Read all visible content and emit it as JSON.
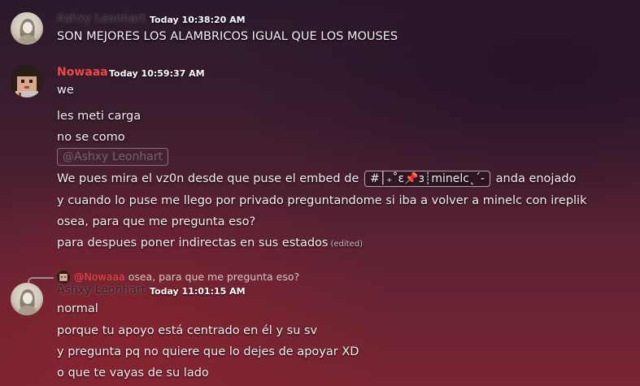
{
  "messages": [
    {
      "author": "Ashxy Leonhart",
      "timestamp": "Today 10:38:20 AM",
      "lines": [
        "SON MEJORES LOS ALAMBRICOS IGUAL QUE LOS MOUSES"
      ]
    },
    {
      "author": "Nowaaa",
      "timestamp": "Today 10:59:37 AM",
      "lines": [
        "we",
        "les meti carga",
        "no se como",
        "@Ashxy Leonhart",
        "We pues mira el vz0n desde que puse el embed de",
        "#│₊˚ɛ📌ɜ┊minelc˛ˊ-",
        "anda enojado",
        "y cuando lo puse me llego por privado preguntandome si iba a volver a minelc con ireplik",
        "osea, para que me pregunta eso?",
        "para despues poner indirectas en sus estados",
        "(edited)"
      ]
    },
    {
      "reply_to": {
        "author": "@Nowaaa",
        "text": "osea, para que me pregunta eso?"
      },
      "author": "Ashxy Leonhart",
      "timestamp": "Today 11:01:15 AM",
      "lines": [
        "normal",
        "porque tu apoyo está centrado en él y su sv",
        "y pregunta pq no quiere que lo dejes de apoyar XD",
        "o que te vayas de su lado"
      ]
    }
  ]
}
